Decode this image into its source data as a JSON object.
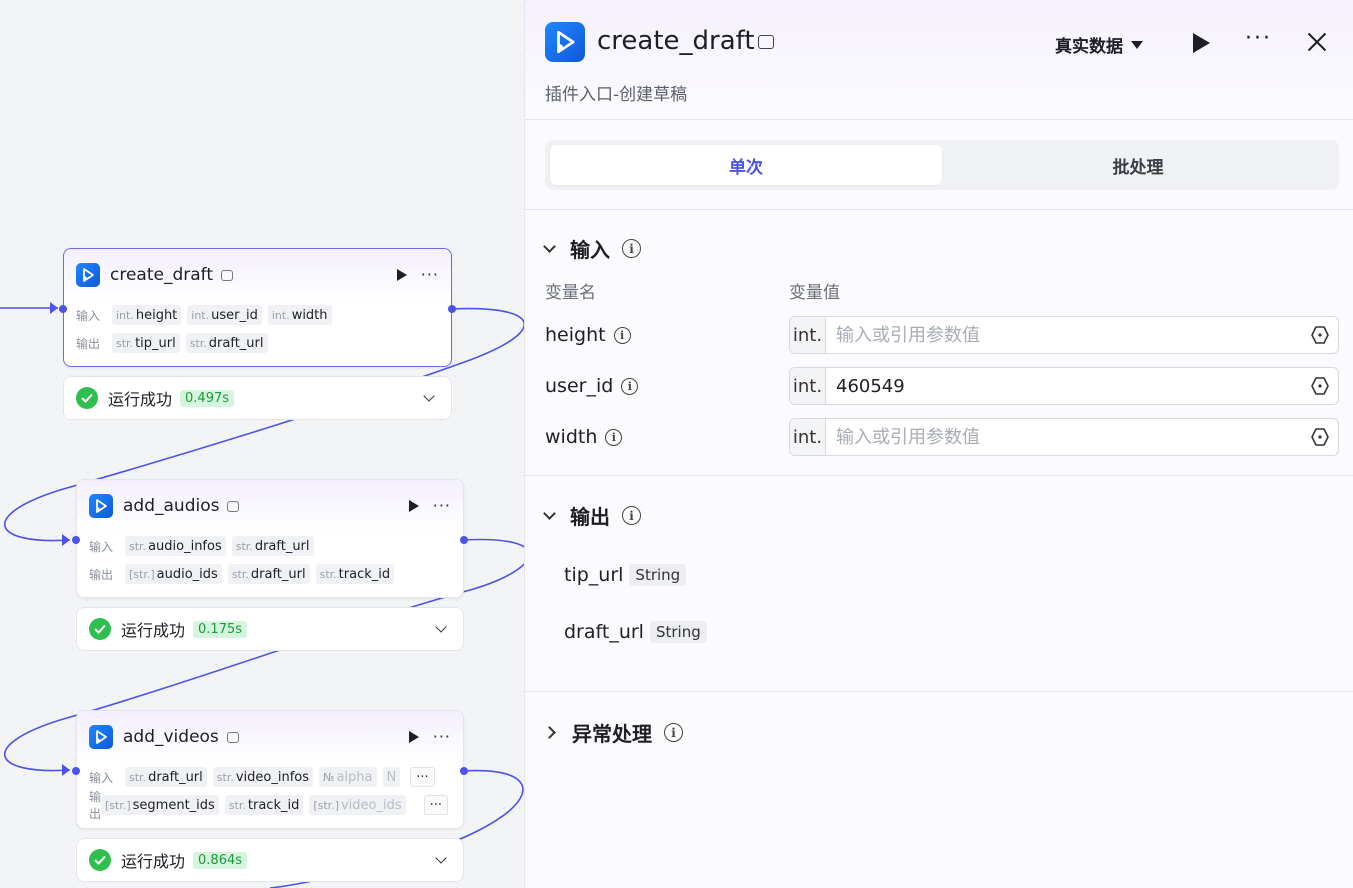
{
  "canvas": {
    "nodes": [
      {
        "title": "create_draft",
        "input_label": "输入",
        "output_label": "输出",
        "inputs": [
          {
            "type": "int.",
            "name": "height"
          },
          {
            "type": "int.",
            "name": "user_id"
          },
          {
            "type": "int.",
            "name": "width"
          }
        ],
        "outputs": [
          {
            "type": "str.",
            "name": "tip_url"
          },
          {
            "type": "str.",
            "name": "draft_url"
          }
        ],
        "status": {
          "text": "运行成功",
          "time": "0.497s"
        }
      },
      {
        "title": "add_audios",
        "input_label": "输入",
        "output_label": "输出",
        "inputs": [
          {
            "type": "str.",
            "name": "audio_infos"
          },
          {
            "type": "str.",
            "name": "draft_url"
          }
        ],
        "outputs": [
          {
            "type": "[str.]",
            "name": "audio_ids"
          },
          {
            "type": "str.",
            "name": "draft_url"
          },
          {
            "type": "str.",
            "name": "track_id"
          }
        ],
        "status": {
          "text": "运行成功",
          "time": "0.175s"
        }
      },
      {
        "title": "add_videos",
        "input_label": "输入",
        "output_label": "输出",
        "inputs": [
          {
            "type": "str.",
            "name": "draft_url"
          },
          {
            "type": "str.",
            "name": "video_infos"
          },
          {
            "type": "№",
            "name": "alpha"
          },
          {
            "type": "",
            "name": "N"
          }
        ],
        "outputs": [
          {
            "type": "[str.]",
            "name": "segment_ids"
          },
          {
            "type": "str.",
            "name": "track_id"
          },
          {
            "type": "[str.]",
            "name": "video_ids"
          }
        ],
        "more": "···",
        "status": {
          "text": "运行成功",
          "time": "0.864s"
        }
      }
    ]
  },
  "panel": {
    "title": "create_draft",
    "description": "插件入口-创建草稿",
    "data_mode": "真实数据",
    "tabs": [
      {
        "label": "单次",
        "active": true
      },
      {
        "label": "批处理",
        "active": false
      }
    ],
    "input_section": {
      "title": "输入",
      "col_name": "变量名",
      "col_value": "变量值",
      "vars": [
        {
          "name": "height",
          "type": "int.",
          "value": "",
          "placeholder": "输入或引用参数值"
        },
        {
          "name": "user_id",
          "type": "int.",
          "value": "460549",
          "placeholder": "输入或引用参数值"
        },
        {
          "name": "width",
          "type": "int.",
          "value": "",
          "placeholder": "输入或引用参数值"
        }
      ]
    },
    "output_section": {
      "title": "输出",
      "vars": [
        {
          "name": "tip_url",
          "type": "String"
        },
        {
          "name": "draft_url",
          "type": "String"
        }
      ]
    },
    "exception_section": {
      "title": "异常处理"
    }
  },
  "colors": {
    "accent": "#4d53e8",
    "success": "#2fbf4f",
    "brand_icon": "#1e88ff"
  }
}
